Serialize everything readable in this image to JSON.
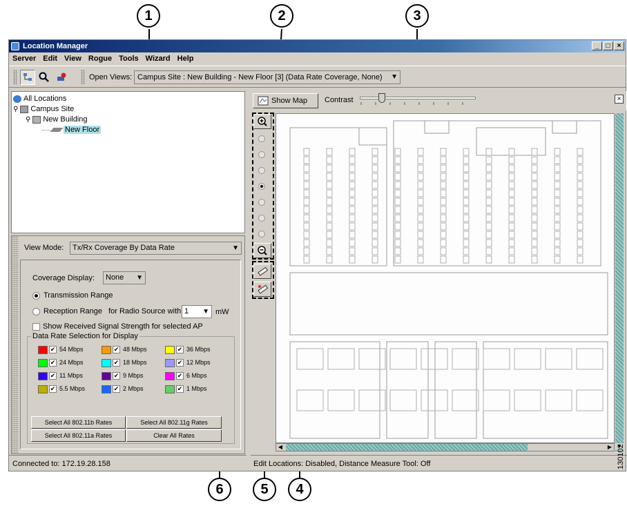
{
  "callouts": [
    "1",
    "2",
    "3",
    "4",
    "5",
    "6"
  ],
  "window": {
    "title": "Location Manager",
    "controls": [
      "_",
      "□",
      "×"
    ]
  },
  "menu": [
    "Server",
    "Edit",
    "View",
    "Rogue",
    "Tools",
    "Wizard",
    "Help"
  ],
  "toolbar": {
    "open_views_label": "Open Views:",
    "open_views_value": "Campus Site : New Building - New Floor [3] (Data Rate Coverage, None)"
  },
  "tree": {
    "root": "All Locations",
    "campus": "Campus Site",
    "building": "New Building",
    "floor": "New Floor"
  },
  "view_mode": {
    "label": "View Mode:",
    "value": "Tx/Rx Coverage By Data Rate"
  },
  "coverage": {
    "display_label": "Coverage Display:",
    "display_value": "None",
    "transmission_range": "Transmission Range",
    "reception_range": "Reception Range",
    "radio_source_label": "for Radio Source with",
    "radio_source_value": "1",
    "unit": "mW",
    "show_signal": "Show Received Signal Strength for selected AP"
  },
  "rates": {
    "legend": "Data Rate Selection for Display",
    "items": [
      {
        "label": "54 Mbps",
        "color": "#ff0000"
      },
      {
        "label": "48 Mbps",
        "color": "#ff9900"
      },
      {
        "label": "36 Mbps",
        "color": "#ffff00"
      },
      {
        "label": "24 Mbps",
        "color": "#00ff00"
      },
      {
        "label": "18 Mbps",
        "color": "#00ffff"
      },
      {
        "label": "12 Mbps",
        "color": "#9999ff"
      },
      {
        "label": "11 Mbps",
        "color": "#3300ff"
      },
      {
        "label": "9 Mbps",
        "color": "#660099"
      },
      {
        "label": "6 Mbps",
        "color": "#ff00ff"
      },
      {
        "label": "5.5 Mbps",
        "color": "#b8b000"
      },
      {
        "label": "2 Mbps",
        "color": "#1a66ff"
      },
      {
        "label": "1 Mbps",
        "color": "#66cc66"
      }
    ],
    "buttons": [
      "Select All 802.11b Rates",
      "Select All 802.11g Rates",
      "Select All 802.11a Rates",
      "Clear All Rates"
    ]
  },
  "map": {
    "show_map": "Show Map",
    "contrast_label": "Contrast",
    "close": "×"
  },
  "status": {
    "left": "Connected to: 172.19.28.158",
    "right": "Edit Locations: Disabled, Distance Measure Tool: Off"
  },
  "figure_number": "130102"
}
